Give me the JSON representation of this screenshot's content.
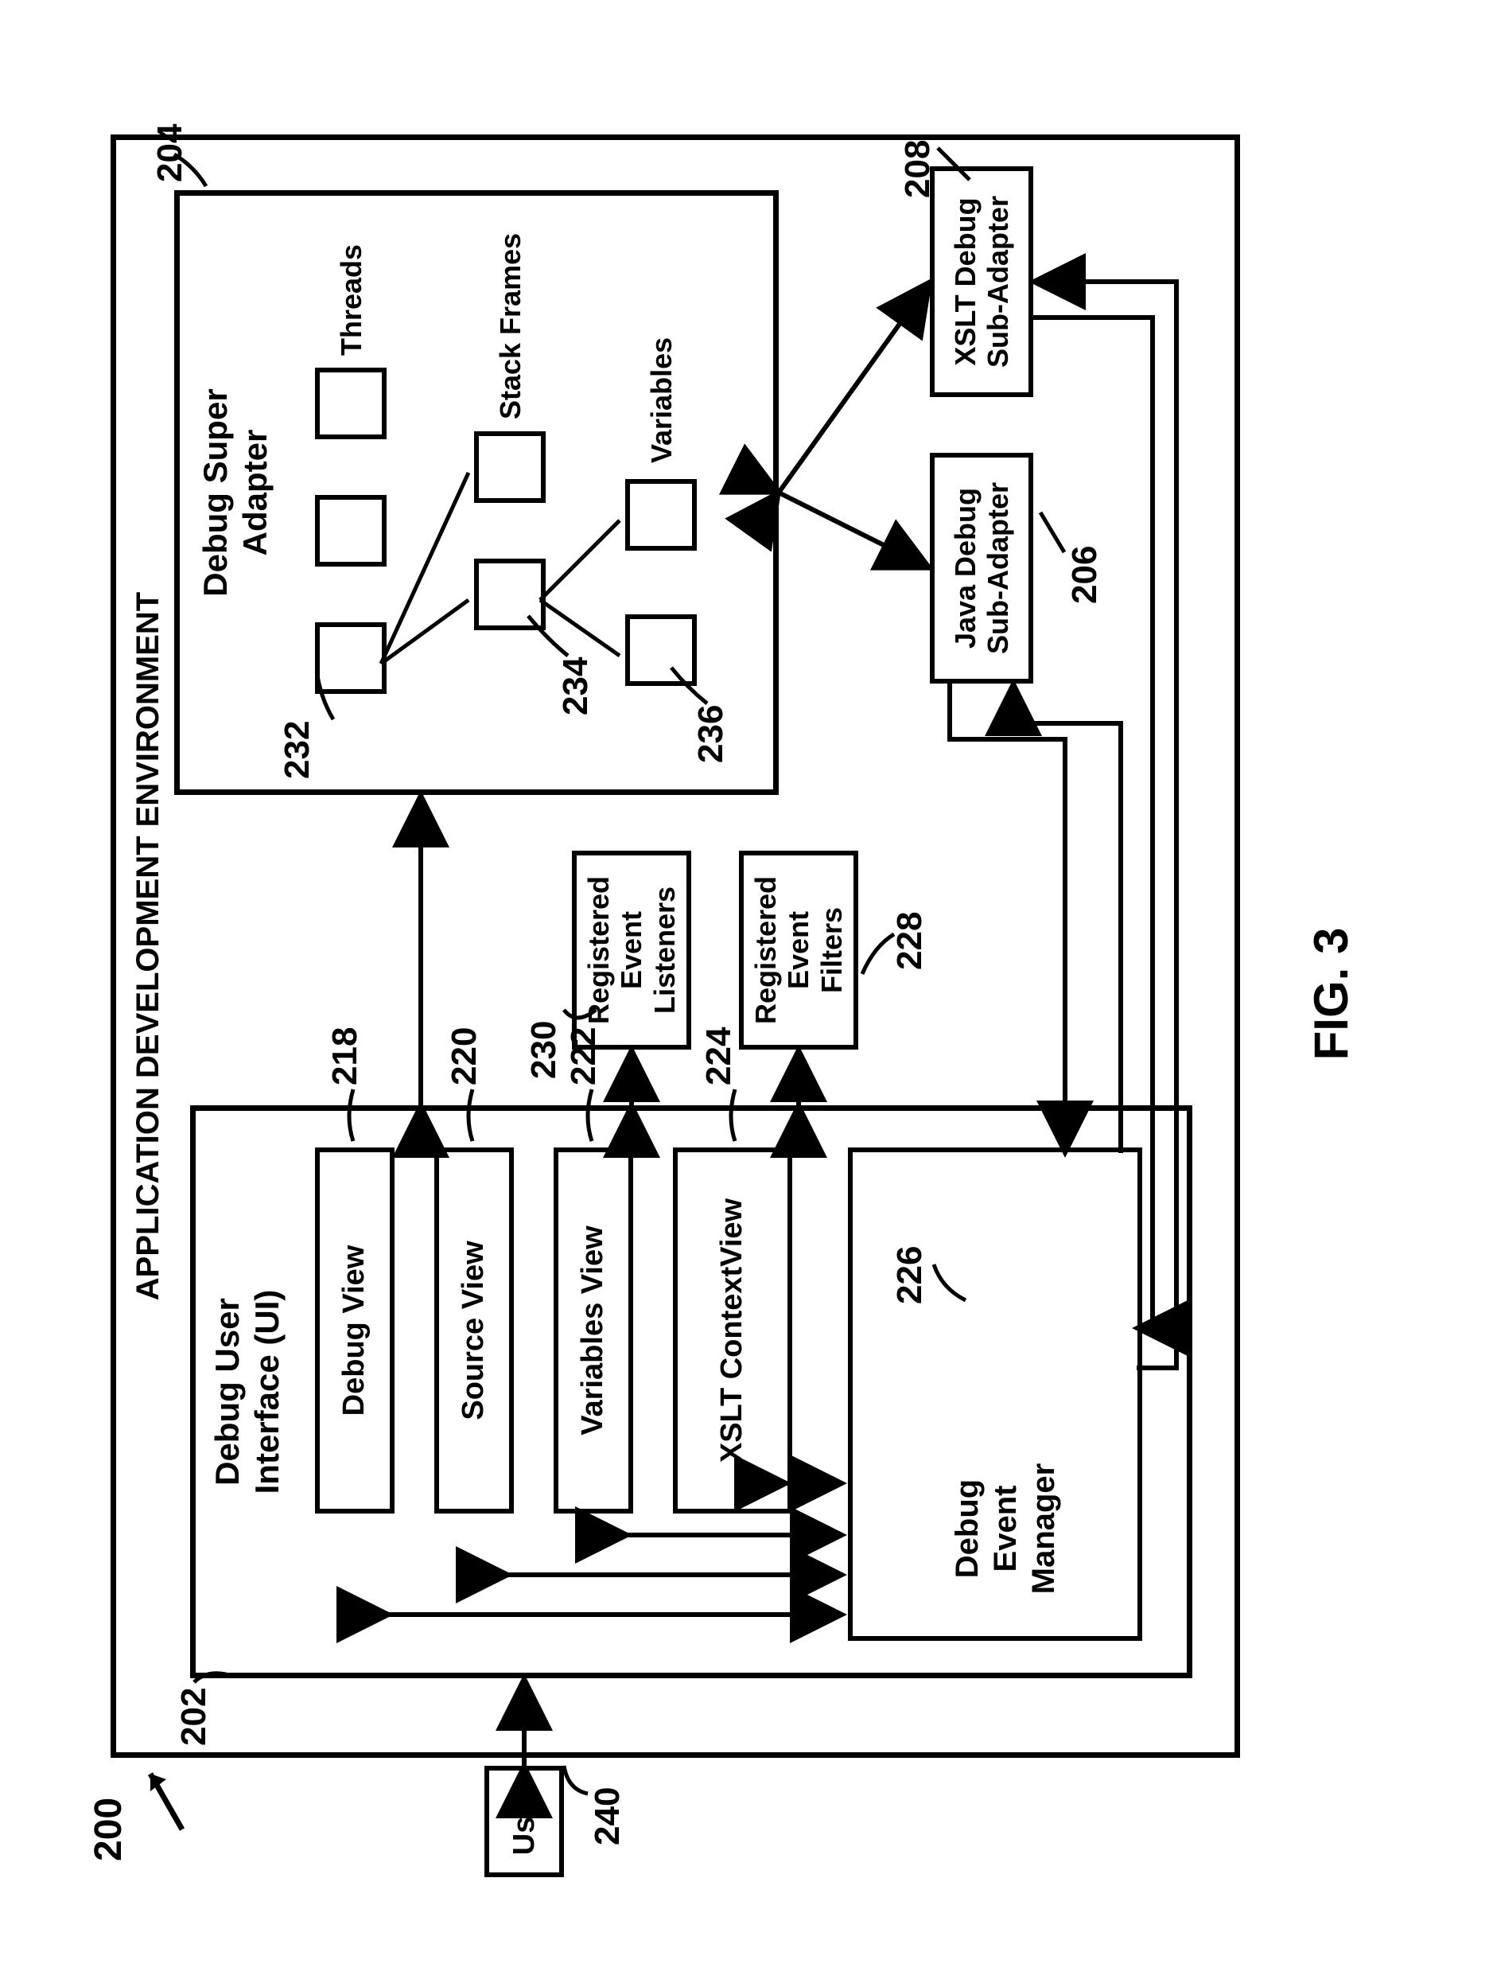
{
  "figure_label": "FIG. 3",
  "env_title": "APPLICATION DEVELOPMENT ENVIRONMENT",
  "ref_200": "200",
  "user": {
    "label": "User",
    "ref": "240"
  },
  "ui": {
    "title_line1": "Debug User",
    "title_line2": "Interface (UI)",
    "ref": "202",
    "views": {
      "debug_view": {
        "label": "Debug View",
        "ref": "218"
      },
      "source_view": {
        "label": "Source View",
        "ref": "220"
      },
      "variables_view": {
        "label": "Variables View",
        "ref": "222"
      },
      "xslt_context_view": {
        "label_line1": "XSLT Context",
        "label_line2": "View",
        "ref": "224"
      }
    },
    "debug_event_manager": {
      "label_line1": "Debug Event",
      "label_line2": "Manager",
      "ref": "226"
    }
  },
  "registered_event_listeners": {
    "label_line1": "Registered",
    "label_line2": "Event",
    "label_line3": "Listeners",
    "ref": "230"
  },
  "registered_event_filters": {
    "label_line1": "Registered",
    "label_line2": "Event",
    "label_line3": "Filters",
    "ref": "228"
  },
  "super_adapter": {
    "title_line1": "Debug Super",
    "title_line2": "Adapter",
    "ref": "204",
    "threads_label": "Threads",
    "thread_ref": "232",
    "stack_frames_label": "Stack Frames",
    "stack_frame_ref": "234",
    "variables_label": "Variables",
    "variable_ref": "236"
  },
  "java_sub": {
    "label_line1": "Java Debug",
    "label_line2": "Sub-Adapter",
    "ref": "206"
  },
  "xslt_sub": {
    "label_line1": "XSLT Debug",
    "label_line2": "Sub-Adapter",
    "ref": "208"
  }
}
